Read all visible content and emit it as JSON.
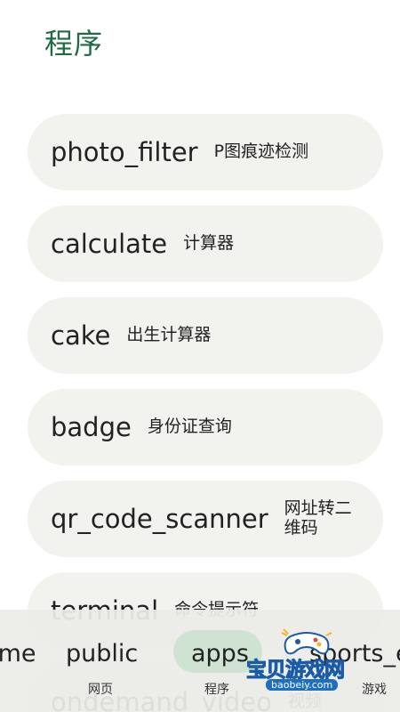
{
  "header": {
    "title": "程序"
  },
  "apps": [
    {
      "name": "photo_filter",
      "desc": "P图痕迹检测"
    },
    {
      "name": "calculate",
      "desc": "计算器"
    },
    {
      "name": "cake",
      "desc": "出生计算器"
    },
    {
      "name": "badge",
      "desc": "身份证查询"
    },
    {
      "name": "qr_code_scanner",
      "desc": "网址转二维码"
    },
    {
      "name": "terminal",
      "desc": "命令提示符"
    },
    {
      "name": "ondemand_video",
      "desc": "视频"
    }
  ],
  "bottom_nav": {
    "items": [
      {
        "label": "home",
        "sub": ""
      },
      {
        "label": "public",
        "sub": "网页"
      },
      {
        "label": "apps",
        "sub": "程序"
      },
      {
        "label": "sports_esports",
        "sub": "游戏"
      }
    ],
    "selected": "apps",
    "selected_color": "#cfe3d2"
  },
  "watermark": {
    "text": "宝贝游戏网",
    "url": "baobeiy.com"
  },
  "colors": {
    "title": "#1f6b43",
    "card_bg": "#f2f2ef"
  }
}
